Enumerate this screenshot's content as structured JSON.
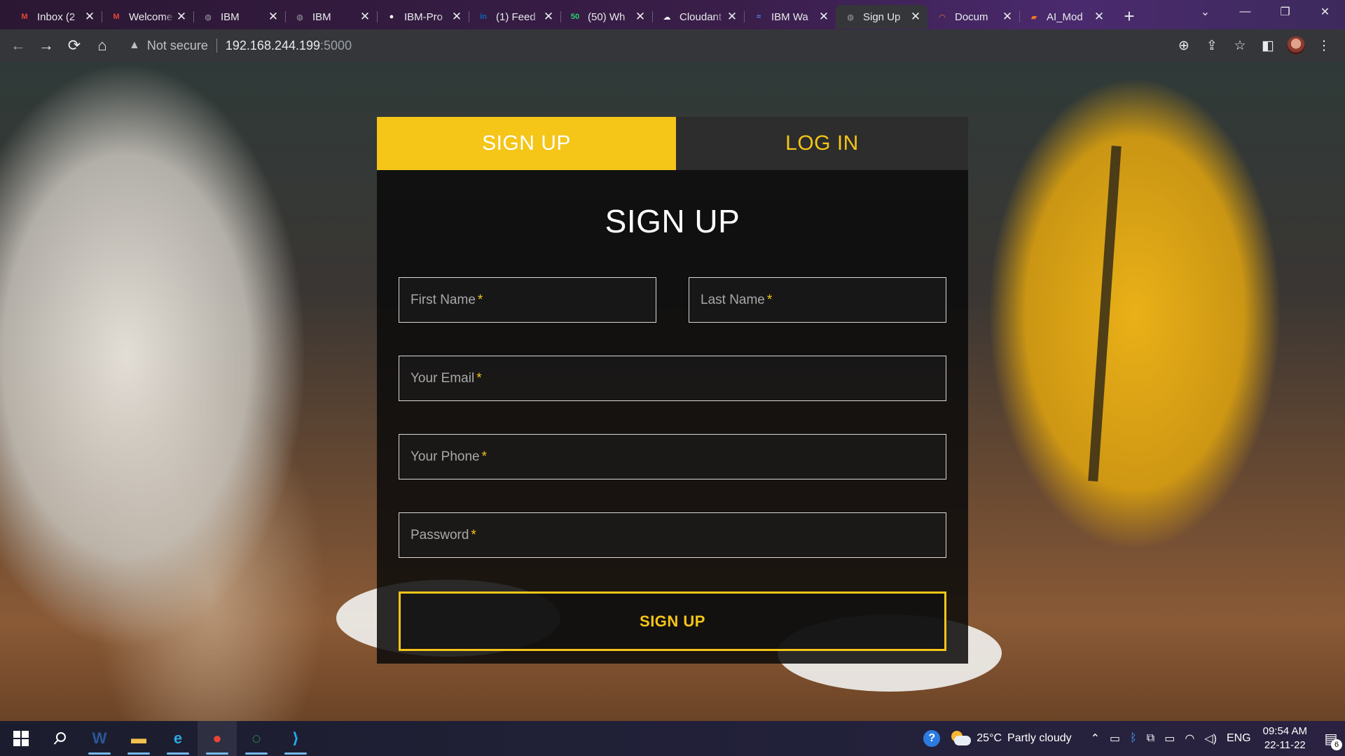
{
  "browser": {
    "tabs": [
      {
        "title": "Inbox (2",
        "icon": "gmail-icon",
        "color": "#ea4335",
        "glyph": "M"
      },
      {
        "title": "Welcome",
        "icon": "gmail-icon",
        "color": "#ea4335",
        "glyph": "M"
      },
      {
        "title": "IBM",
        "icon": "globe-icon",
        "color": "#9aa0a6",
        "glyph": "◍"
      },
      {
        "title": "IBM",
        "icon": "globe-icon",
        "color": "#9aa0a6",
        "glyph": "◍"
      },
      {
        "title": "IBM-Pro",
        "icon": "github-icon",
        "color": "#ffffff",
        "glyph": "●"
      },
      {
        "title": "(1) Feed",
        "icon": "linkedin-icon",
        "color": "#0a66c2",
        "glyph": "in"
      },
      {
        "title": "(50) Wh",
        "icon": "whatsapp-icon",
        "color": "#25d366",
        "glyph": "50"
      },
      {
        "title": "Cloudant",
        "icon": "cloudant-icon",
        "color": "#ffffff",
        "glyph": "☁"
      },
      {
        "title": "IBM Wa",
        "icon": "ibm-watson-icon",
        "color": "#4589ff",
        "glyph": "≈"
      },
      {
        "title": "Sign Up",
        "icon": "globe-icon",
        "color": "#9aa0a6",
        "glyph": "◍",
        "active": true
      },
      {
        "title": "Docum",
        "icon": "jupyter-icon",
        "color": "#f37626",
        "glyph": "◠"
      },
      {
        "title": "AI_Mod",
        "icon": "notebook-icon",
        "color": "#f37626",
        "glyph": "▰"
      }
    ],
    "close_glyph": "✕",
    "new_tab_glyph": "+",
    "window_controls": {
      "dropdown": "⌄",
      "minimize": "—",
      "restore": "❐",
      "close": "✕"
    },
    "nav": {
      "back": "←",
      "forward": "→",
      "reload": "⟳",
      "home": "⌂"
    },
    "address": {
      "warning_icon": "▲",
      "security_label": "Not secure",
      "host": "192.168.244.199",
      "port": ":5000"
    },
    "toolbar_icons": {
      "zoom": "⊕",
      "share": "⇪",
      "bookmark": "☆",
      "sidepanel": "◧",
      "menu": "⋮"
    }
  },
  "form": {
    "tab_signup": "SIGN UP",
    "tab_login": "LOG IN",
    "heading": "SIGN UP",
    "required_mark": "*",
    "fields": {
      "first_name": "First Name",
      "last_name": "Last Name",
      "email": "Your Email",
      "phone": "Your Phone",
      "password": "Password"
    },
    "submit_label": "SIGN UP",
    "colors": {
      "accent": "#f5c518",
      "panel": "#0a0a0a",
      "tab_inactive": "#2d2d2d"
    }
  },
  "taskbar": {
    "apps": [
      {
        "name": "word-icon",
        "glyph": "W",
        "color": "#2b579a"
      },
      {
        "name": "file-explorer-icon",
        "glyph": "▬",
        "color": "#f2c14e"
      },
      {
        "name": "edge-icon",
        "glyph": "e",
        "color": "#2fa8e0"
      },
      {
        "name": "chrome-icon",
        "glyph": "●",
        "color": "#ea4335"
      },
      {
        "name": "loader-app-icon",
        "glyph": "◌",
        "color": "#35c759"
      },
      {
        "name": "vscode-icon",
        "glyph": "⟩",
        "color": "#23a9f2"
      }
    ],
    "weather": {
      "temp": "25°C",
      "condition": "Partly cloudy"
    },
    "language": "ENG",
    "time": "09:54 AM",
    "date": "22-11-22",
    "notification_count": "6"
  }
}
